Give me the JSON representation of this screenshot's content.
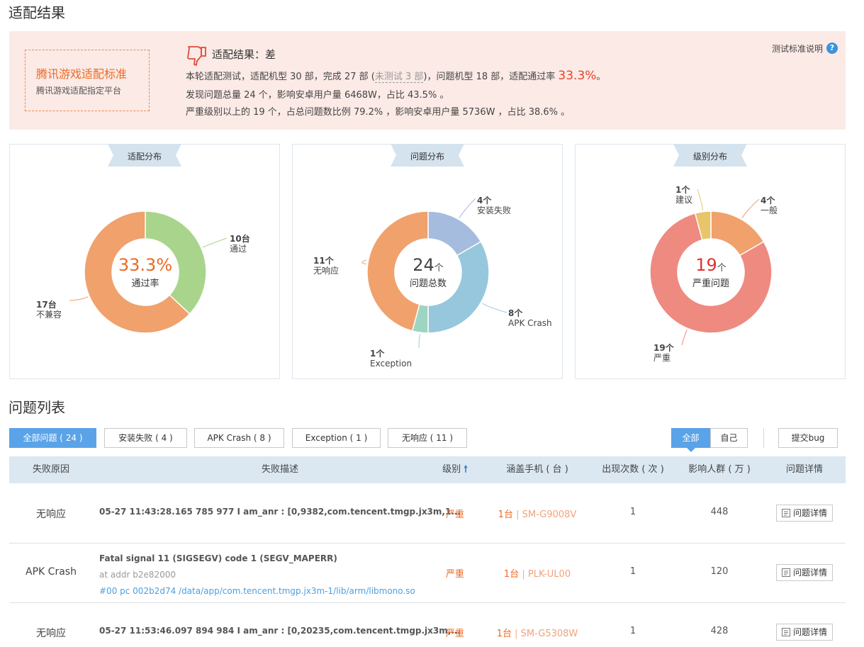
{
  "page": {
    "title": "适配结果"
  },
  "summary": {
    "standard_title": "腾讯游戏适配标准",
    "standard_sub": "腾讯游戏适配指定平台",
    "result_title": "适配结果：差",
    "line1_a": "本轮适配测试，适配机型 30 部，完成 27 部 (",
    "line1_untested": "未测试 3 部",
    "line1_b": ")，问题机型 18 部，适配通过率",
    "line1_rate": "33.3%",
    "line1_end": "。",
    "line2": "发现问题总量 24 个，影响安卓用户量 6468W，占比 43.5% 。",
    "line3": "严重级别以上的 19 个，占总问题数比例 79.2% ，影响安卓用户量 5736W ，占比 38.6% 。",
    "std_link": "测试标准说明",
    "help_icon": "question-icon"
  },
  "colors": {
    "accent_blue": "#5aa3e8",
    "orange": "#f0a16c",
    "green": "#a8d58b",
    "light_blue": "#96c7dc",
    "lavender": "#a5bcdf",
    "mint": "#9ed4c2",
    "salmon": "#ee8a80",
    "yellow": "#e8c46b",
    "severe_text": "#ee6a24"
  },
  "chart_data": [
    {
      "type": "pie",
      "title": "适配分布",
      "center_value": "33.3%",
      "center_label": "通过率",
      "slices": [
        {
          "count": "10台",
          "label": "通过",
          "value": 10,
          "color": "#a8d58b"
        },
        {
          "count": "17台",
          "label": "不兼容",
          "value": 17,
          "color": "#f0a16c"
        }
      ]
    },
    {
      "type": "pie",
      "title": "问题分布",
      "center_value": "24",
      "center_unit": "个",
      "center_label": "问题总数",
      "slices": [
        {
          "count": "4个",
          "label": "安装失败",
          "value": 4,
          "color": "#a5bcdf"
        },
        {
          "count": "8个",
          "label": "APK Crash",
          "value": 8,
          "color": "#96c7dc"
        },
        {
          "count": "1个",
          "label": "Exception",
          "value": 1,
          "color": "#9ed4c2"
        },
        {
          "count": "11个",
          "label": "无响应",
          "value": 11,
          "color": "#f0a16c"
        }
      ]
    },
    {
      "type": "pie",
      "title": "级别分布",
      "center_value": "19",
      "center_unit": "个",
      "center_label": "严重问题",
      "slices": [
        {
          "count": "4个",
          "label": "一般",
          "value": 4,
          "color": "#f0a16c"
        },
        {
          "count": "19个",
          "label": "严重",
          "value": 19,
          "color": "#ee8a80"
        },
        {
          "count": "1个",
          "label": "建议",
          "value": 1,
          "color": "#e8c46b"
        }
      ]
    }
  ],
  "list": {
    "title": "问题列表",
    "tabs": [
      "全部问题 ( 24 )",
      "安装失败 ( 4 )",
      "APK Crash ( 8 )",
      "Exception ( 1 )",
      "无响应 ( 11 )"
    ],
    "scope_all": "全部",
    "scope_self": "自己",
    "submit": "提交bug",
    "headers": [
      "失败原因",
      "失败描述",
      "级别",
      "涵盖手机 ( 台 )",
      "出现次数 ( 次 )",
      "影响人群 ( 万 )",
      "问题详情"
    ],
    "sort_icon": "arrow-up-icon",
    "rows": [
      {
        "reason": "无响应",
        "desc": "05-27 11:43:28.165 785 977 I am_anr : [0,9382,com.tencent.tmgp.jx3m,1...",
        "level": "严重",
        "devices": "1台",
        "model": "SM-G9008V",
        "count": "1",
        "impact": "448",
        "detail": "问题详情"
      },
      {
        "reason": "APK Crash",
        "desc": "Fatal signal 11 (SIGSEGV) code 1 (SEGV_MAPERR)",
        "desc_sub": "at addr b2e82000",
        "desc_link": "#00 pc 002b2d74 /data/app/com.tencent.tmgp.jx3m-1/lib/arm/libmono.so",
        "level": "严重",
        "devices": "1台",
        "model": "PLK-UL00",
        "count": "1",
        "impact": "120",
        "detail": "问题详情"
      },
      {
        "reason": "无响应",
        "desc": "05-27 11:53:46.097 894 984 I am_anr : [0,20235,com.tencent.tmgp.jx3m,...",
        "level": "严重",
        "devices": "1台",
        "model": "SM-G5308W",
        "count": "1",
        "impact": "428",
        "detail": "问题详情"
      }
    ]
  }
}
